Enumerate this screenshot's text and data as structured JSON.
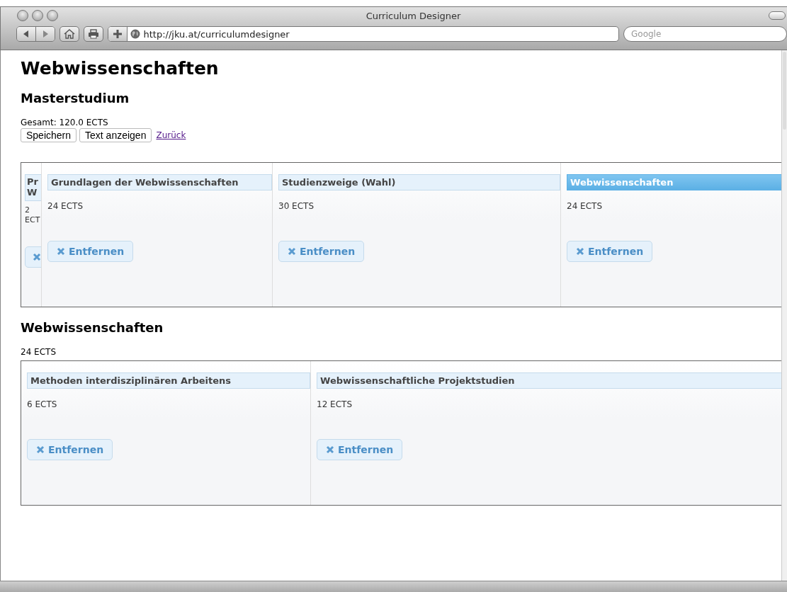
{
  "window": {
    "title": "Curriculum Designer",
    "url": "http://jku.at/curriculumdesigner",
    "search_placeholder": "Google"
  },
  "page": {
    "title": "Webwissenschaften",
    "subtitle": "Masterstudium",
    "total": "Gesamt: 120.0 ECTS",
    "buttons": [
      "Speichern",
      "Text anzeigen"
    ],
    "link": "Zurück"
  },
  "panels": [
    {
      "modules": [
        {
          "title": "Pr W",
          "ects": "2 ECT",
          "clipped": true,
          "selected": false
        },
        {
          "title": "Grundlagen der Webwissenschaften",
          "ects": "24 ECTS",
          "button": "Entfernen",
          "clipped": false,
          "selected": false
        },
        {
          "title": "Studienzweige (Wahl)",
          "ects": "30 ECTS",
          "button": "Entfernen",
          "clipped": false,
          "selected": false
        },
        {
          "title": "Webwissenschaften",
          "ects": "24 ECTS",
          "button": "Entfernen",
          "clipped": false,
          "selected": true
        }
      ]
    },
    {
      "heading": "Webwissenschaften",
      "ects": "24 ECTS",
      "modules": [
        {
          "title": "Methoden interdisziplinären Arbeitens",
          "ects": "6 ECTS",
          "button": "Entfernen",
          "clipped": false,
          "selected": false
        },
        {
          "title": "Webwissenschaftliche Projektstudien",
          "ects": "12 ECTS",
          "button": "Entfernen",
          "clipped": false,
          "selected": false
        }
      ]
    }
  ]
}
